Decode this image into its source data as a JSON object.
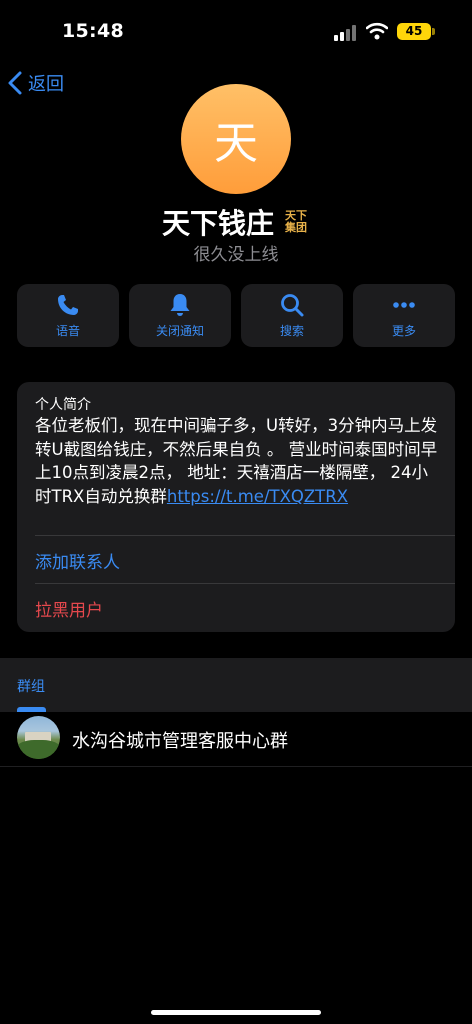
{
  "status_bar": {
    "time": "15:48",
    "battery": "45"
  },
  "nav": {
    "back_label": "返回"
  },
  "profile": {
    "avatar_letter": "天",
    "name": "天下钱庄",
    "seal_line1": "天下",
    "seal_line2": "集团",
    "status": "很久没上线"
  },
  "actions": [
    {
      "label": "语音",
      "icon": "phone-icon"
    },
    {
      "label": "关闭通知",
      "icon": "bell-icon"
    },
    {
      "label": "搜索",
      "icon": "search-icon"
    },
    {
      "label": "更多",
      "icon": "more-icon"
    }
  ],
  "bio_card": {
    "title": "个人简介",
    "text": "各位老板们，现在中间骗子多，U转好，3分钟内马上发转U截图给钱庄，不然后果自负 。 营业时间泰国时间早上10点到凌晨2点， 地址：天禧酒店一楼隔壁， 24小时TRX自动兑换群",
    "link": "https://t.me/TXQZTRX",
    "add_contact": "添加联系人",
    "block_user": "拉黑用户"
  },
  "groups": {
    "tab_label": "群组",
    "items": [
      {
        "name": "水沟谷城市管理客服中心群"
      }
    ]
  },
  "colors": {
    "accent": "#3a8bf2",
    "danger": "#e5484d",
    "card": "#1c1c1e",
    "avatar": "#ffa94d"
  }
}
